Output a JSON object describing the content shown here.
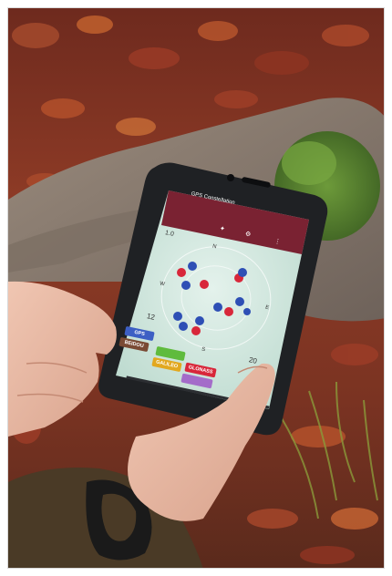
{
  "photo": {
    "description_tag": "",
    "colors": {
      "leaf_bg": "#8a3a26",
      "moss": "#4f7a2a",
      "rock": "#8a7c70",
      "phone_frame": "#1f2124",
      "screen_bg": "#cfe6dc",
      "header": "#7a2232",
      "jacket": "#4a3a26",
      "skin": "#e7b8a4",
      "dot_red": "#d8273a",
      "dot_blue": "#2e4fb5"
    }
  },
  "screen": {
    "status_time": "",
    "header_title": "GPS Constellation",
    "readout_top_left": "1.0",
    "readout_mid_left": "12",
    "readout_bottom_right": "20",
    "compass": {
      "north": "N",
      "west": "W",
      "east": "E",
      "south": "S"
    },
    "buttons": [
      {
        "label": "GPS",
        "color": "#3d5fc4"
      },
      {
        "label": "BEIDOU",
        "color": "#7a4a34"
      },
      {
        "label": "",
        "color": "#5fbb3d"
      },
      {
        "label": "GALILEO",
        "color": "#e2a81f"
      },
      {
        "label": "GLONASS",
        "color": "#d8273a"
      },
      {
        "label": "",
        "color": "#a46cc9"
      }
    ],
    "icons": [
      "satellite-icon",
      "settings-icon",
      "menu-icon"
    ]
  }
}
